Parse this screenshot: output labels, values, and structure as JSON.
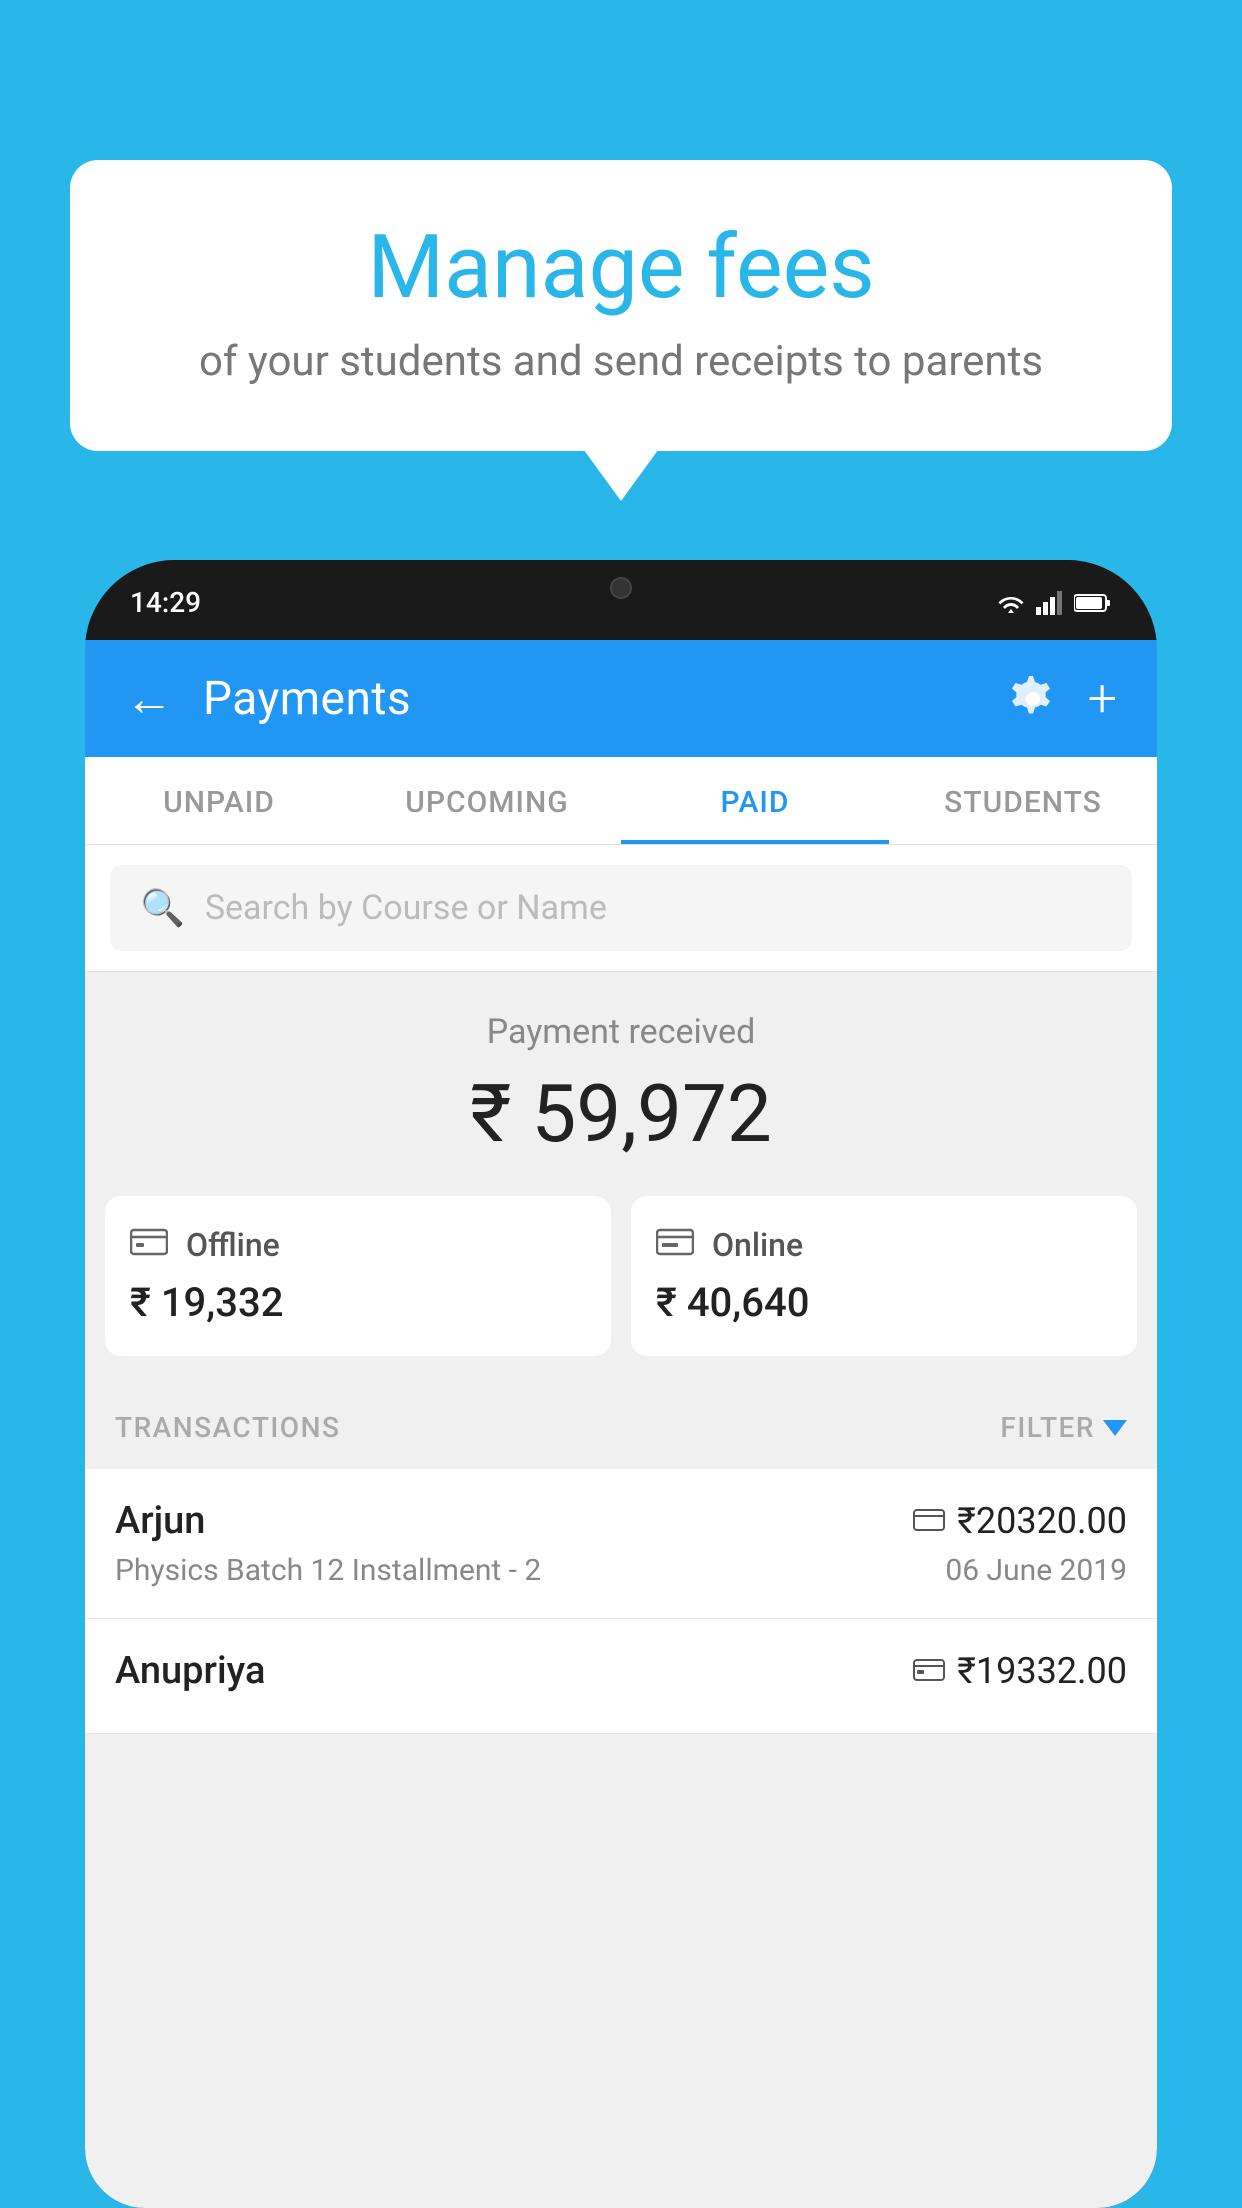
{
  "background_color": "#29b6e8",
  "bubble": {
    "title": "Manage fees",
    "subtitle": "of your students and send receipts to parents"
  },
  "status_bar": {
    "time": "14:29",
    "icons": [
      "wifi",
      "signal",
      "battery"
    ]
  },
  "header": {
    "title": "Payments",
    "back_label": "←",
    "settings_label": "⚙",
    "add_label": "+"
  },
  "tabs": [
    {
      "label": "UNPAID",
      "active": false
    },
    {
      "label": "UPCOMING",
      "active": false
    },
    {
      "label": "PAID",
      "active": true
    },
    {
      "label": "STUDENTS",
      "active": false
    }
  ],
  "search": {
    "placeholder": "Search by Course or Name"
  },
  "payment_summary": {
    "label": "Payment received",
    "amount": "₹ 59,972",
    "offline": {
      "label": "Offline",
      "amount": "₹ 19,332"
    },
    "online": {
      "label": "Online",
      "amount": "₹ 40,640"
    }
  },
  "transactions": {
    "section_label": "TRANSACTIONS",
    "filter_label": "FILTER",
    "rows": [
      {
        "name": "Arjun",
        "course": "Physics Batch 12 Installment - 2",
        "amount": "₹20320.00",
        "date": "06 June 2019",
        "payment_type": "online"
      },
      {
        "name": "Anupriya",
        "course": "",
        "amount": "₹19332.00",
        "date": "",
        "payment_type": "offline"
      }
    ]
  }
}
